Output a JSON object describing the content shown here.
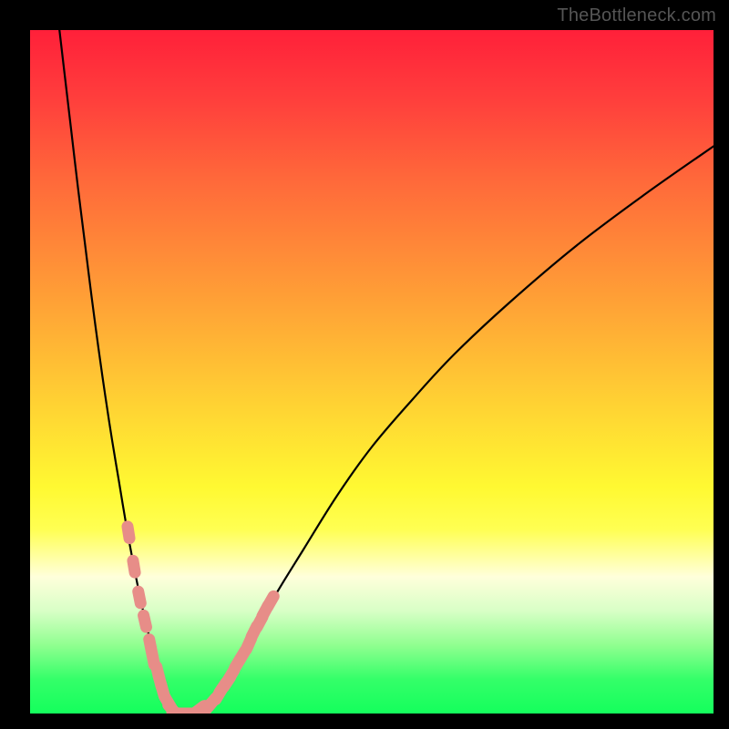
{
  "watermark": {
    "text": "TheBottleneck.com"
  },
  "colors": {
    "curve_stroke": "#000000",
    "marker_fill": "#e78d88",
    "marker_stroke": "#e78d88"
  },
  "chart_data": {
    "type": "line",
    "title": "",
    "xlabel": "",
    "ylabel": "",
    "xlim": [
      0,
      100
    ],
    "ylim": [
      0,
      100
    ],
    "grid": false,
    "legend": false,
    "series": [
      {
        "name": "bottleneck-curve",
        "x": [
          4.3,
          5,
          6,
          7,
          8,
          9,
          10,
          11,
          12,
          13,
          14,
          15,
          16,
          17,
          18,
          18.7,
          19.3,
          20.7,
          21.3,
          22,
          23,
          24,
          25,
          27,
          29,
          31,
          33,
          36,
          40,
          45,
          50,
          56,
          62,
          70,
          80,
          90,
          100
        ],
        "y": [
          100,
          94,
          85.5,
          77,
          69,
          61,
          53.5,
          46.5,
          40,
          34,
          28,
          22.5,
          17.5,
          13,
          9,
          6.3,
          4,
          1.3,
          0.6,
          0,
          0,
          0,
          0,
          1.5,
          4.5,
          8,
          12,
          17.5,
          24,
          32,
          39,
          46,
          52.5,
          60,
          68.5,
          76,
          83
        ]
      }
    ],
    "markers": {
      "name": "highlighted-points",
      "segments": [
        {
          "x": [
            14.4,
            15.2,
            16.0,
            16.8
          ],
          "y": [
            26.5,
            21.5,
            17.0,
            13.5
          ]
        },
        {
          "x": [
            17.6,
            18.0
          ],
          "y": [
            10.0,
            8.0
          ]
        },
        {
          "x": [
            18.7,
            19.0,
            19.4
          ],
          "y": [
            6.0,
            4.8,
            3.4
          ]
        },
        {
          "x": [
            20.2,
            20.8,
            21.6,
            22.4,
            23.2,
            24.0,
            24.8
          ],
          "y": [
            1.6,
            0.6,
            0.0,
            0.0,
            0.0,
            0.0,
            0.6
          ]
        },
        {
          "x": [
            26.0,
            26.6
          ],
          "y": [
            0.9,
            1.6
          ]
        },
        {
          "x": [
            27.6,
            28.2,
            28.8,
            29.4
          ],
          "y": [
            2.8,
            3.8,
            4.6,
            5.6
          ]
        },
        {
          "x": [
            30.4,
            31.0
          ],
          "y": [
            7.4,
            8.4
          ]
        },
        {
          "x": [
            32.0,
            32.8,
            33.6,
            34.4,
            35.2
          ],
          "y": [
            10.2,
            12.0,
            13.4,
            15.0,
            16.4
          ]
        }
      ]
    }
  }
}
